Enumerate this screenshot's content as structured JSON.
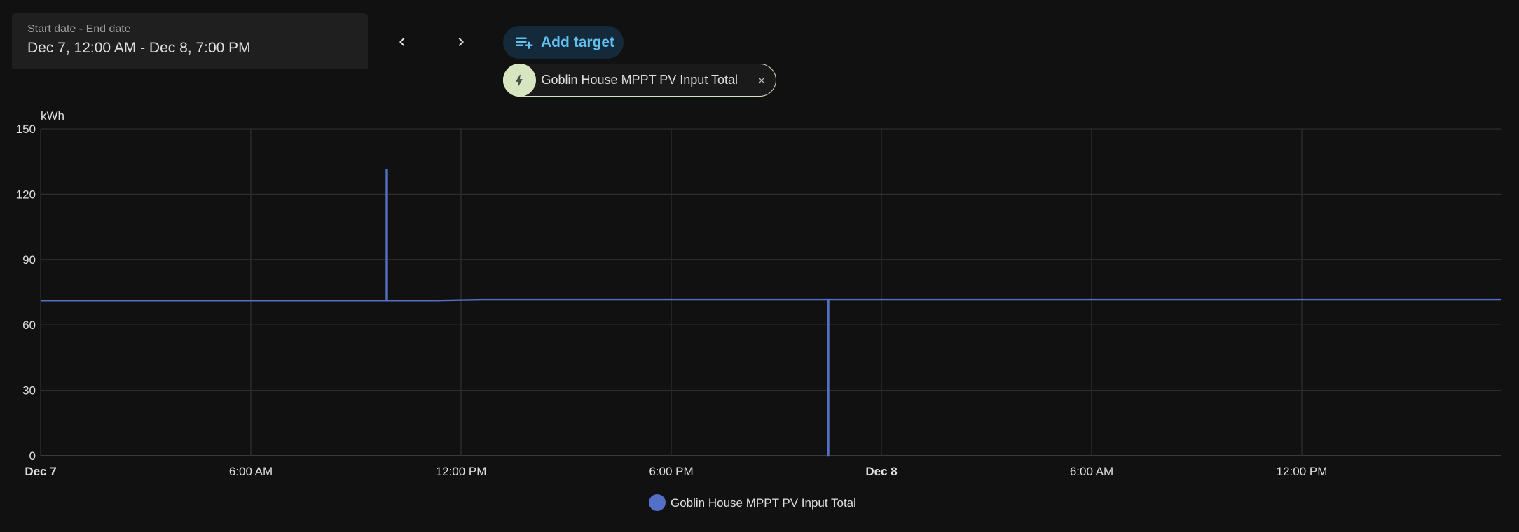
{
  "date_picker": {
    "label": "Start date - End date",
    "value": "Dec 7, 12:00 AM - Dec 8, 7:00 PM"
  },
  "nav": {
    "prev_icon": "chevron-left-icon",
    "next_icon": "chevron-right-icon"
  },
  "add_target": {
    "label": "Add target",
    "icon": "playlist-plus-icon"
  },
  "target_chip": {
    "label": "Goblin House MPPT PV Input Total",
    "icon": "lightning-bolt-icon",
    "remove_icon": "close-icon"
  },
  "colors": {
    "series": "#5470c6",
    "accent": "#5fc2f3",
    "background": "#111111"
  },
  "chart_data": {
    "type": "line",
    "title": "",
    "ylabel": "kWh",
    "xlabel": "",
    "ylim": [
      0,
      150
    ],
    "yticks": [
      0,
      30,
      60,
      90,
      120,
      150
    ],
    "x_unit": "hours since Dec 7 12:00 AM",
    "xlim": [
      0,
      41.7
    ],
    "xticks": [
      {
        "x": 0,
        "label": "Dec 7",
        "bold": true
      },
      {
        "x": 6,
        "label": "6:00 AM",
        "bold": false
      },
      {
        "x": 12,
        "label": "12:00 PM",
        "bold": false
      },
      {
        "x": 18,
        "label": "6:00 PM",
        "bold": false
      },
      {
        "x": 24,
        "label": "Dec 8",
        "bold": true
      },
      {
        "x": 30,
        "label": "6:00 AM",
        "bold": false
      },
      {
        "x": 36,
        "label": "12:00 PM",
        "bold": false
      }
    ],
    "grid": true,
    "legend_position": "bottom-center",
    "series": [
      {
        "name": "Goblin House MPPT PV Input Total",
        "points": [
          [
            0,
            71.2
          ],
          [
            9.87,
            71.2
          ],
          [
            9.87,
            131
          ],
          [
            9.89,
            131
          ],
          [
            9.89,
            71.2
          ],
          [
            11.3,
            71.2
          ],
          [
            12.6,
            71.6
          ],
          [
            22.47,
            71.6
          ],
          [
            22.47,
            0
          ],
          [
            22.49,
            0
          ],
          [
            22.49,
            71.6
          ],
          [
            41.7,
            71.6
          ]
        ]
      }
    ]
  }
}
